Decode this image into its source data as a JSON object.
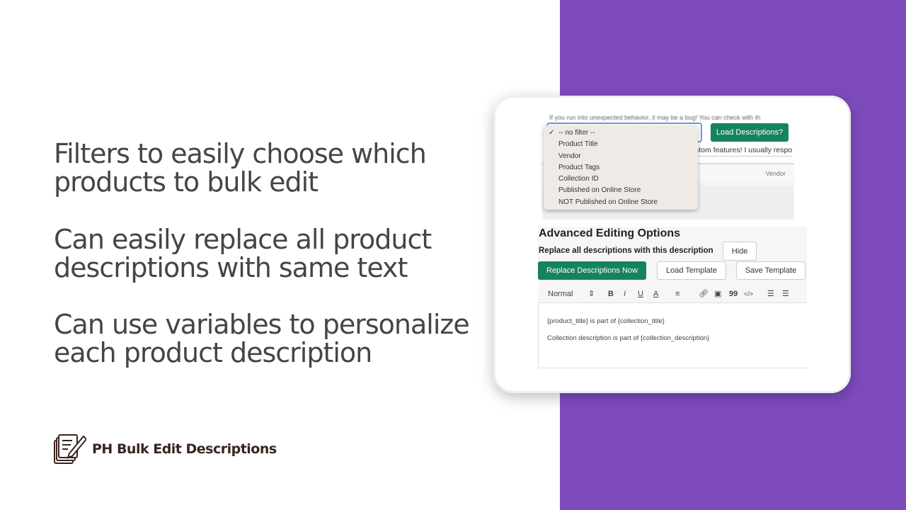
{
  "features": [
    [
      "Filters to easily choose which",
      "products to bulk edit"
    ],
    [
      "Can easily replace all product",
      "descriptions with same text"
    ],
    [
      "Can use variables to personalize",
      "each product description"
    ]
  ],
  "brand": {
    "name": "PH Bulk Edit Descriptions",
    "icon": "notepad-pencil-icon"
  },
  "colors": {
    "accent": "#7e4bbd",
    "button": "#16835f"
  },
  "screen": {
    "top_notice": "If you run into unexpected behavior, it may be a bug! You can check with th",
    "second_notice": "stom features! I usually respo",
    "load_button": "Load Descriptions?",
    "table_header_vendor": "Vendor",
    "filter_menu": {
      "selected": "-- no filter --",
      "options": [
        "-- no filter --",
        "Product Title",
        "Vendor",
        "Product Tags",
        "Collection ID",
        "Published on Online Store",
        "NOT Published on Online Store"
      ]
    },
    "advanced": {
      "title": "Advanced Editing Options",
      "replace_label": "Replace all descriptions with this description",
      "hide_button": "Hide",
      "replace_button": "Replace Descriptions Now",
      "load_template": "Load Template",
      "save_template": "Save Template",
      "toolbar": {
        "format": "Normal",
        "bold": "B",
        "italic": "I",
        "underline": "U",
        "color": "A",
        "quote": "99",
        "code": "</>"
      },
      "editor_lines": [
        "{product_title} is part of {collection_title}",
        "Collection description is part of {collection_description}"
      ]
    }
  }
}
